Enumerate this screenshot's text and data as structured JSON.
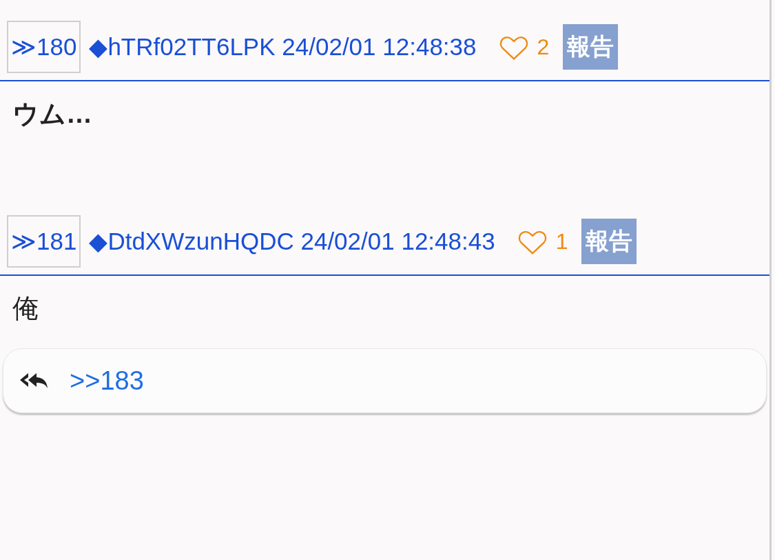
{
  "posts": [
    {
      "number": "≫180",
      "user_id": "◆hTRf02TT6LPK",
      "date": "24/02/01 12:48:38",
      "likes": "2",
      "report": "報告",
      "body": "ウム…",
      "bold": true
    },
    {
      "number": "≫181",
      "user_id": "◆DtdXWzunHQDC",
      "date": "24/02/01 12:48:43",
      "likes": "1",
      "report": "報告",
      "body": "俺",
      "bold": false
    }
  ],
  "reply": {
    "label": ">>183"
  }
}
